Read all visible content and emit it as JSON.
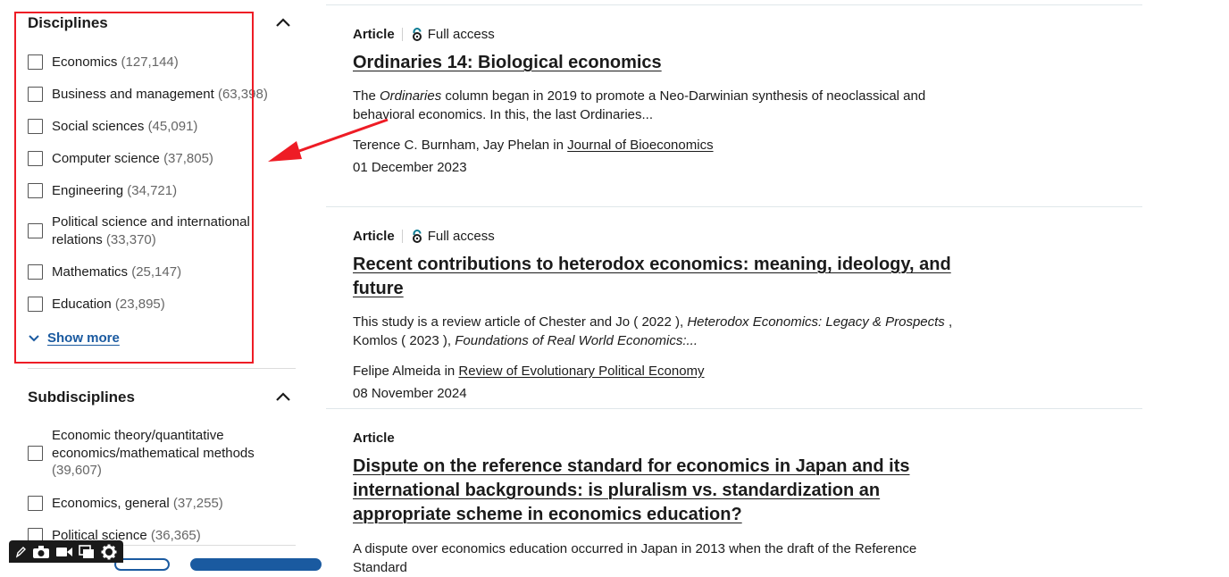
{
  "sidebar": {
    "disciplines": {
      "title": "Disciplines",
      "options": [
        {
          "label": "Economics",
          "count": "(127,144)"
        },
        {
          "label": "Business and management",
          "count": "(63,398)"
        },
        {
          "label": "Social sciences",
          "count": "(45,091)"
        },
        {
          "label": "Computer science",
          "count": "(37,805)"
        },
        {
          "label": "Engineering",
          "count": "(34,721)"
        },
        {
          "label": "Political science and international relations",
          "count": "(33,370)"
        },
        {
          "label": "Mathematics",
          "count": "(25,147)"
        },
        {
          "label": "Education",
          "count": "(23,895)"
        }
      ],
      "show_more": "Show more"
    },
    "subdisciplines": {
      "title": "Subdisciplines",
      "options": [
        {
          "label": "Economic theory/quantitative economics/mathematical methods",
          "count": "(39,607)"
        },
        {
          "label": "Economics, general",
          "count": "(37,255)"
        },
        {
          "label": "Political science",
          "count": "(36,365)"
        }
      ]
    }
  },
  "results": [
    {
      "type": "Article",
      "access": "Full access",
      "title": "Ordinaries 14: Biological economics",
      "snippet": {
        "pre": "The ",
        "em": "Ordinaries",
        "post": " column began in 2019 to promote a Neo-Darwinian synthesis of neoclassical and behavioral economics. In this, the last Ordinaries..."
      },
      "authors": "Terence C. Burnham, Jay Phelan",
      "in_word": "in",
      "journal": "Journal of Bioeconomics",
      "date": "01 December 2023"
    },
    {
      "type": "Article",
      "access": "Full access",
      "title": "Recent contributions to heterodox economics: meaning, ideology, and future",
      "snippet": {
        "p1": "This study is a review article of Chester and Jo ( 2022 ), ",
        "em1": "Heterodox Economics: Legacy & Prospects",
        "p2": " , Komlos ( 2023 ), ",
        "em2": "Foundations of Real World Economics:..."
      },
      "authors": "Felipe Almeida",
      "in_word": "in",
      "journal": "Review of Evolutionary Political Economy",
      "date": "08 November 2024"
    },
    {
      "type": "Article",
      "title": "Dispute on the reference standard for economics in Japan and its international backgrounds: is pluralism vs. standardization an appropriate scheme in economics education?",
      "snippet": "A dispute over economics education occurred in Japan in 2013 when the draft of the Reference Standard"
    }
  ],
  "colors": {
    "annotation_red": "#ee1c25",
    "link_blue": "#1a5aa0",
    "access_teal": "#0c7b93"
  },
  "icons": [
    "chevron-up-icon",
    "chevron-down-icon",
    "open-access-icon",
    "arrow-annotation",
    "pen-icon",
    "camera-icon",
    "video-icon",
    "window-icon",
    "gear-icon"
  ]
}
